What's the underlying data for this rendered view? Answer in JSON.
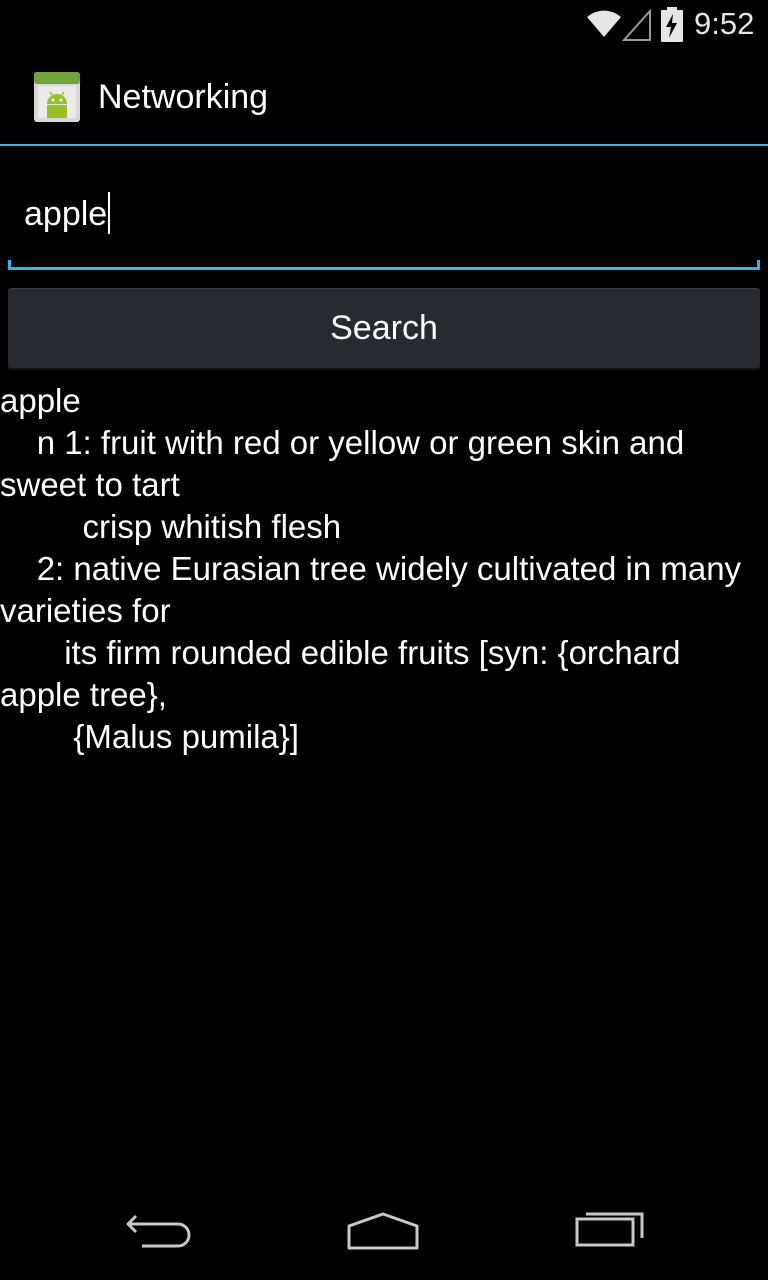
{
  "status_bar": {
    "time": "9:52",
    "icons": [
      "wifi-icon",
      "cell-signal-icon",
      "battery-charging-icon"
    ]
  },
  "action_bar": {
    "app_icon": "android-app-icon",
    "title": "Networking"
  },
  "search": {
    "input_value": "apple",
    "button_label": "Search"
  },
  "result": {
    "text": "apple\n    n 1: fruit with red or yellow or green skin and sweet to tart\n         crisp whitish flesh\n    2: native Eurasian tree widely cultivated in many varieties for\n       its firm rounded edible fruits [syn: {orchard apple tree},\n        {Malus pumila}]"
  },
  "nav_bar": {
    "icons": [
      "back-icon",
      "home-icon",
      "recents-icon"
    ]
  },
  "colors": {
    "accent": "#33b5e5",
    "background": "#000000",
    "button": "#272a2e"
  }
}
